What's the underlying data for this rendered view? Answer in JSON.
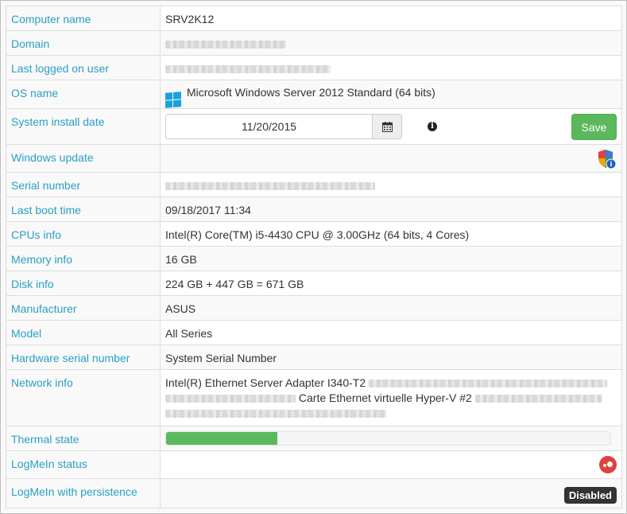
{
  "rows": {
    "computer_name": {
      "label": "Computer name",
      "value": "SRV2K12"
    },
    "domain": {
      "label": "Domain"
    },
    "last_user": {
      "label": "Last logged on user"
    },
    "os_name": {
      "label": "OS name",
      "value": "Microsoft Windows Server 2012 Standard (64 bits)"
    },
    "install_date": {
      "label": "System install date",
      "value": "11/20/2015",
      "save_label": "Save"
    },
    "windows_update": {
      "label": "Windows update"
    },
    "serial_number": {
      "label": "Serial number"
    },
    "last_boot": {
      "label": "Last boot time",
      "value": "09/18/2017 11:34"
    },
    "cpus": {
      "label": "CPUs info",
      "value": "Intel(R) Core(TM) i5-4430 CPU @ 3.00GHz (64 bits, 4 Cores)"
    },
    "memory": {
      "label": "Memory info",
      "value": "16 GB"
    },
    "disk": {
      "label": "Disk info",
      "value": "224 GB + 447 GB = 671 GB"
    },
    "manufacturer": {
      "label": "Manufacturer",
      "value": "ASUS"
    },
    "model": {
      "label": "Model",
      "value": "All Series"
    },
    "hw_serial": {
      "label": "Hardware serial number",
      "value": "System Serial Number"
    },
    "network": {
      "label": "Network info",
      "adapter1": "Intel(R) Ethernet Server Adapter I340-T2",
      "adapter2": "Carte Ethernet virtuelle Hyper-V #2"
    },
    "thermal": {
      "label": "Thermal state",
      "progress_fraction": 0.25
    },
    "logmein_status": {
      "label": "LogMeIn status"
    },
    "logmein_persistence": {
      "label": "LogMeIn with persistence",
      "badge": "Disabled"
    }
  },
  "icons": {
    "os": "windows-logo-icon",
    "calendar": "calendar-icon",
    "info": "info-icon",
    "update": "shield-update-icon",
    "logmein": "logmein-icon"
  },
  "colors": {
    "label": "#2a9ec4",
    "success": "#5cb85c",
    "badge": "#333333",
    "logmein": "#e0413a",
    "windows": "#1ba1e2"
  }
}
